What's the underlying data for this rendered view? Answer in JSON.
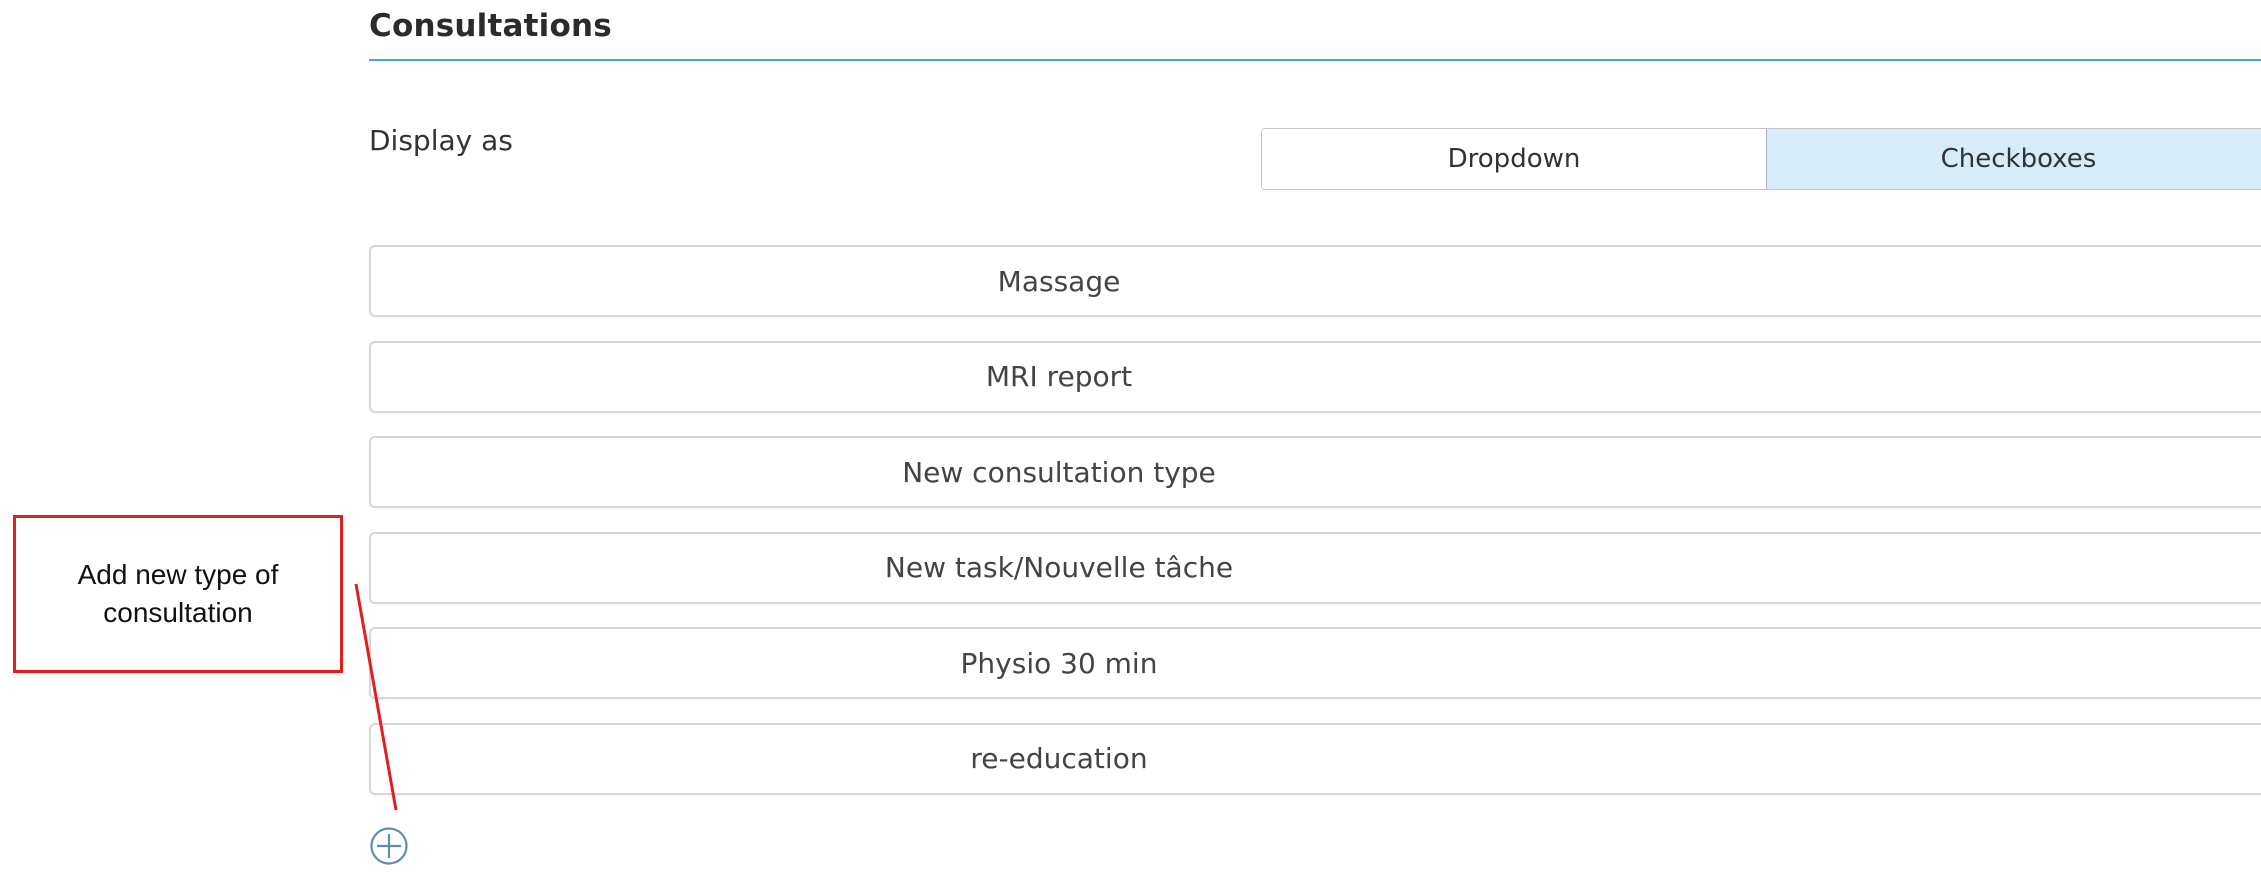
{
  "section": {
    "title": "Consultations"
  },
  "display_as": {
    "label": "Display as",
    "options": [
      {
        "label": "Dropdown",
        "selected": false
      },
      {
        "label": "Checkboxes",
        "selected": true
      }
    ]
  },
  "consultation_types": [
    {
      "label": "Massage"
    },
    {
      "label": "MRI report"
    },
    {
      "label": "New consultation type"
    },
    {
      "label": "New task/Nouvelle tâche"
    },
    {
      "label": "Physio 30 min"
    },
    {
      "label": "re-education"
    }
  ],
  "add_button": {
    "icon": "plus-circle-icon",
    "color": "#5b8fb0"
  },
  "annotation": {
    "text": "Add new type of consultation",
    "color": "#e0201f"
  },
  "colors": {
    "accent_rule": "#4aa3df",
    "selected_segment": "#d6ecf8"
  }
}
